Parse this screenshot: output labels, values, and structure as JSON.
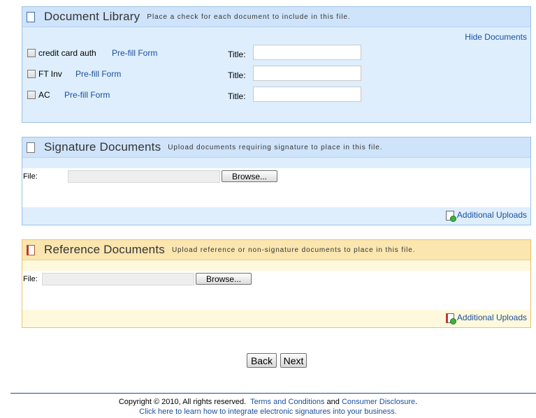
{
  "library": {
    "title": "Document Library",
    "subtitle": "Place a check for each document to include in this file.",
    "hide_link": "Hide Documents",
    "title_label": "Title:",
    "docs": [
      {
        "name": "credit card auth",
        "prefill": "Pre-fill Form",
        "checked": false,
        "title_value": ""
      },
      {
        "name": "FT Inv",
        "prefill": "Pre-fill Form",
        "checked": false,
        "title_value": ""
      },
      {
        "name": "AC",
        "prefill": "Pre-fill Form",
        "checked": false,
        "title_value": ""
      }
    ]
  },
  "signature": {
    "title": "Signature Documents",
    "subtitle": "Upload documents requiring signature to place in this file.",
    "file_label": "File:",
    "browse_label": "Browse...",
    "additional_uploads": "Additional Uploads"
  },
  "reference": {
    "title": "Reference Documents",
    "subtitle": "Upload reference or non-signature documents to place in this file.",
    "file_label": "File:",
    "browse_label": "Browse...",
    "additional_uploads": "Additional Uploads"
  },
  "nav": {
    "back_label": "Back",
    "next_label": "Next"
  },
  "footer": {
    "copyright": "Copyright © 2010, All rights reserved.",
    "terms_link": "Terms and Conditions",
    "and_text": "and",
    "consumer_link": "Consumer Disclosure",
    "period": ".",
    "learn_link": "Click here to learn how to integrate electronic signatures into your business."
  },
  "colors": {
    "link": "#1a4f9c",
    "blue_panel": "#deeefd",
    "gold_panel": "#fef8dd"
  }
}
